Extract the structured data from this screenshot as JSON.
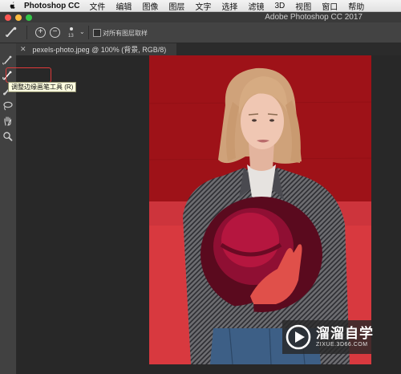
{
  "menubar": {
    "app_name": "Photoshop CC",
    "items": [
      "文件",
      "编辑",
      "图像",
      "图层",
      "文字",
      "选择",
      "滤镜",
      "3D",
      "视图",
      "窗口",
      "帮助"
    ]
  },
  "titlebar": {
    "title": "Adobe Photoshop CC 2017",
    "buttons": [
      "close",
      "minimize",
      "zoom"
    ]
  },
  "options": {
    "brush_size": "13",
    "sample_all_layers_label": "对所有图层取样",
    "sample_all_layers_checked": false
  },
  "tabs": [
    {
      "label": "pexels-photo.jpeg @ 100% (背景, RGB/8)",
      "active": true
    }
  ],
  "toolbox": {
    "tools": [
      "quick-selection-tool",
      "refine-edge-brush-tool",
      "brush-tool",
      "lasso-tool",
      "hand-tool",
      "zoom-tool"
    ],
    "tooltip": "调整边缘画笔工具 (R)"
  },
  "watermark": {
    "brand": "溜溜自学",
    "url": "ZIXUE.3D66.COM"
  },
  "colors": {
    "background_red": "#9e1218",
    "highlight_border": "#e03a3a",
    "selection_overlay": "#e0404a"
  }
}
